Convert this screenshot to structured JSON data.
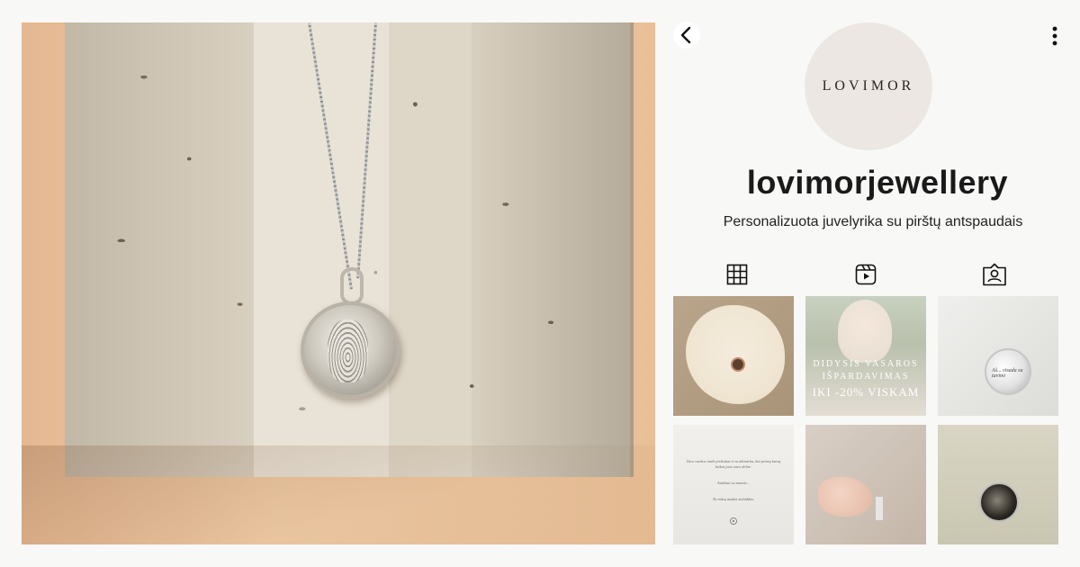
{
  "hero": {
    "alt": ""
  },
  "nav": {
    "back_icon": "chevron-left-icon",
    "more_icon": "more-vertical-icon"
  },
  "profile": {
    "avatar_text": "LOVIMOR",
    "username": "lovimorjewellery",
    "bio": "Personalizuota juvelyrika su pirštų antspaudais"
  },
  "tabs": [
    {
      "icon": "grid-icon"
    },
    {
      "icon": "reels-icon"
    },
    {
      "icon": "tagged-icon"
    }
  ],
  "posts": {
    "p2": {
      "line1": "DIDYSIS VASAROS",
      "line2": "IŠPARDAVIMAS",
      "line3": "IKI -20% VISKAM"
    },
    "p3": {
      "engraving": "Aš... visada su tavimi"
    },
    "p4": {
      "line1": "Tavo rankos maži pirštukai ir ta akimirka, kai pirmą kartą laikai juos savo delne.",
      "line2": "Amžinai su mumis...",
      "line3": "Tu mūsų mažas stebuklas."
    }
  }
}
